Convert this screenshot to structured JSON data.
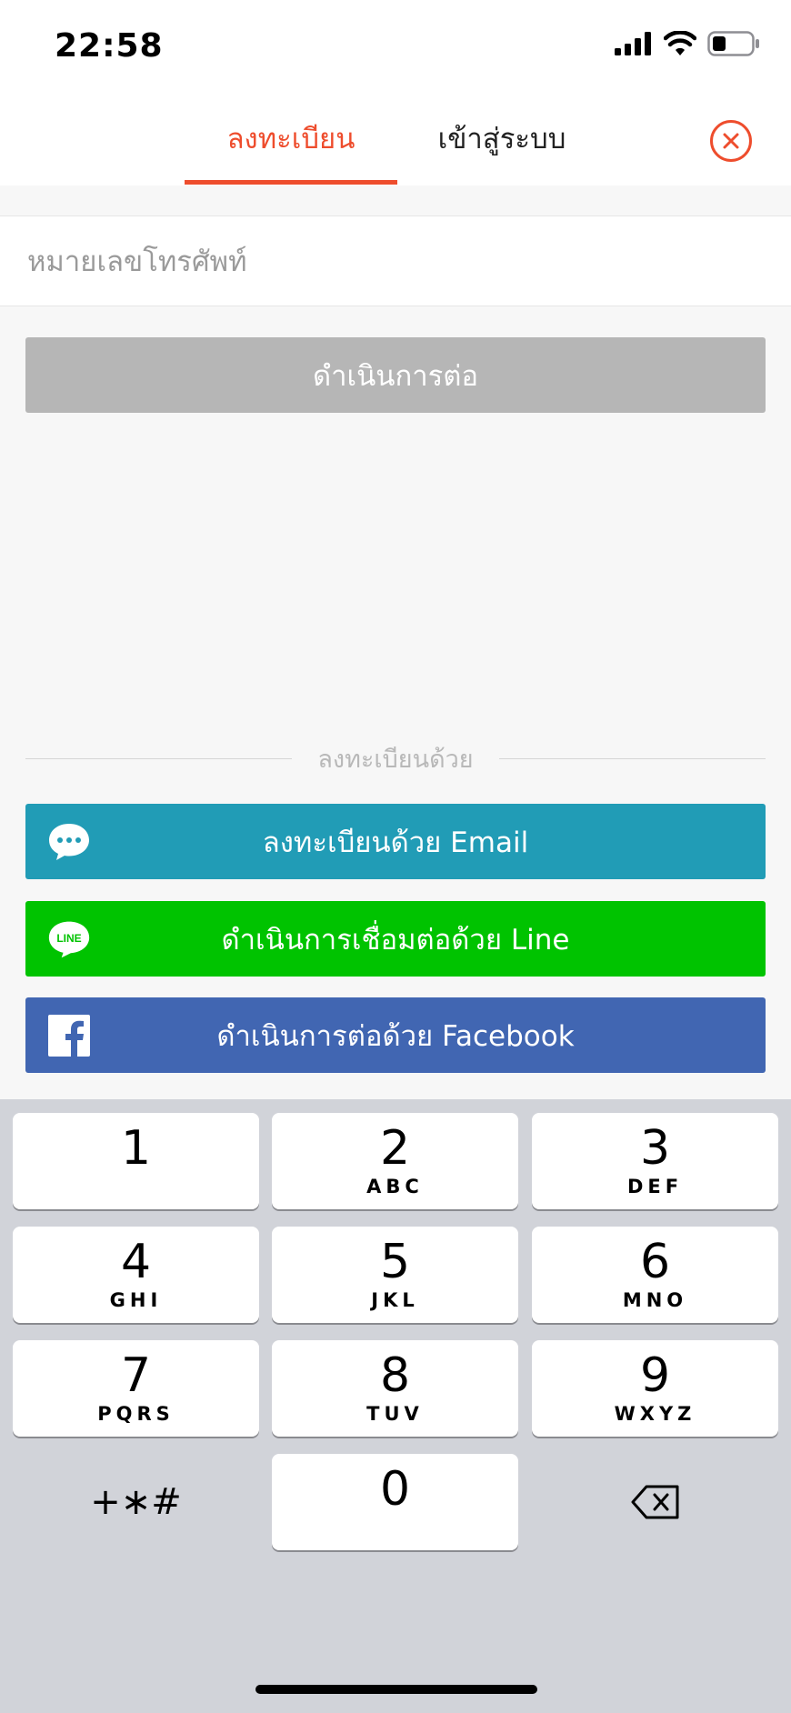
{
  "status": {
    "time": "22:58"
  },
  "header": {
    "tabs": [
      {
        "label": "ลงทะเบียน",
        "active": true
      },
      {
        "label": "เข้าสู่ระบบ",
        "active": false
      }
    ],
    "accent_color": "#ee4d2d"
  },
  "form": {
    "phone_placeholder": "หมายเลขโทรศัพท์",
    "phone_value": "",
    "continue_label": "ดำเนินการต่อ"
  },
  "social": {
    "divider_label": "ลงทะเบียนด้วย",
    "buttons": [
      {
        "label": "ลงทะเบียนด้วย Email",
        "icon": "chat-bubble-icon",
        "color": "#219cb6"
      },
      {
        "label": "ดำเนินการเชื่อมต่อด้วย Line",
        "icon": "line-logo-icon",
        "color": "#00c300",
        "icon_text": "LINE"
      },
      {
        "label": "ดำเนินการต่อด้วย Facebook",
        "icon": "facebook-logo-icon",
        "color": "#4166b2"
      }
    ]
  },
  "keyboard": {
    "keys": [
      {
        "num": "1",
        "letters": ""
      },
      {
        "num": "2",
        "letters": "ABC"
      },
      {
        "num": "3",
        "letters": "DEF"
      },
      {
        "num": "4",
        "letters": "GHI"
      },
      {
        "num": "5",
        "letters": "JKL"
      },
      {
        "num": "6",
        "letters": "MNO"
      },
      {
        "num": "7",
        "letters": "PQRS"
      },
      {
        "num": "8",
        "letters": "TUV"
      },
      {
        "num": "9",
        "letters": "WXYZ"
      },
      {
        "num": "0",
        "letters": ""
      }
    ],
    "symbols_label": "+∗#",
    "delete_icon": "backspace-icon"
  }
}
